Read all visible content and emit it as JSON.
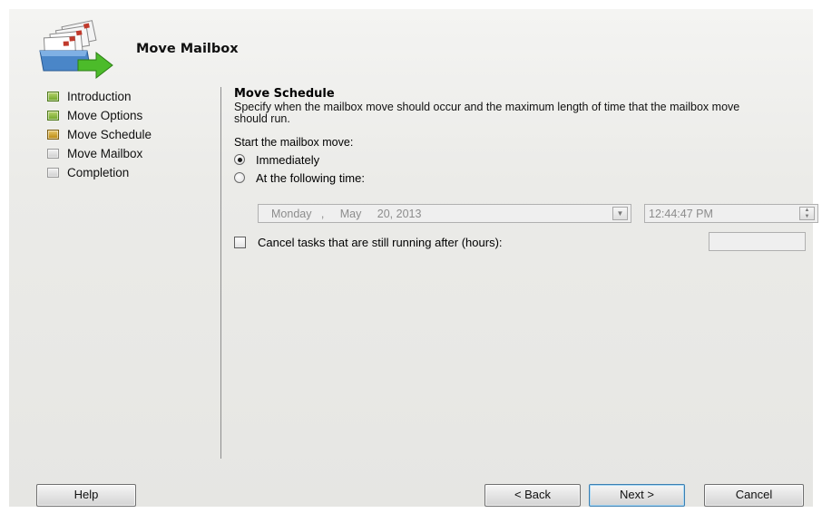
{
  "dialog": {
    "title": "Move Mailbox"
  },
  "steps": [
    {
      "label": "Introduction",
      "state": "done"
    },
    {
      "label": "Move Options",
      "state": "done"
    },
    {
      "label": "Move Schedule",
      "state": "current"
    },
    {
      "label": "Move Mailbox",
      "state": "pending"
    },
    {
      "label": "Completion",
      "state": "pending"
    }
  ],
  "schedule": {
    "heading": "Move Schedule",
    "description": "Specify when the mailbox move should occur and the maximum length of time that the mailbox move should run.",
    "start_label": "Start the mailbox move:",
    "radio_immediately": "Immediately",
    "radio_following_time": "At the following time:",
    "selected_option": "Immediately",
    "date_weekday": "Monday",
    "date_sep": ",",
    "date_month": "May",
    "date_day_year": "20, 2013",
    "time_value": "12:44:47 PM",
    "cancel_checkbox_label": "Cancel tasks that are still running after (hours):",
    "cancel_checked": false,
    "hours_value": ""
  },
  "buttons": {
    "help": "Help",
    "back": "< Back",
    "next": "Next >",
    "cancel": "Cancel"
  },
  "colors": {
    "step_done": "#6ea426",
    "step_current": "#b8860b",
    "step_pending": "#cfcfcf"
  }
}
